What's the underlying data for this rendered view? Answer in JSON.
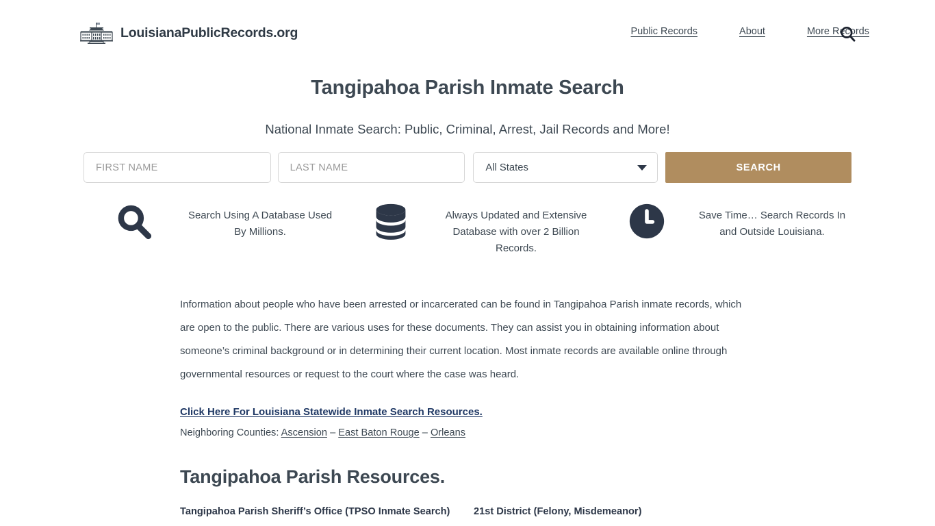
{
  "header": {
    "brand_name": "LouisianaPublicRecords.org",
    "brand_icon": "white-house-icon",
    "nav": [
      {
        "label": "Public Records"
      },
      {
        "label": "About"
      },
      {
        "label": "More Records"
      }
    ],
    "search_icon": "search-icon"
  },
  "hero": {
    "title": "Tangipahoa Parish Inmate Search",
    "subtitle": "National Inmate Search: Public, Criminal, Arrest, Jail Records and More!"
  },
  "search_form": {
    "first_name": {
      "value": "",
      "placeholder": "FIRST NAME"
    },
    "last_name": {
      "value": "",
      "placeholder": "LAST NAME"
    },
    "state_select": {
      "selected": "All States"
    },
    "submit_label": "SEARCH",
    "submit_color": "#b08d5f"
  },
  "features": [
    {
      "icon": "magnifier-icon",
      "text": "Search Using A Database Used By Millions."
    },
    {
      "icon": "database-icon",
      "text": "Always Updated and Extensive Database with over 2 Billion Records."
    },
    {
      "icon": "clock-icon",
      "text": "Save Time… Search Records In and Outside Louisiana."
    }
  ],
  "content": {
    "paragraph": "Information about people who have been arrested or incarcerated can be found in Tangipahoa Parish inmate records, which are open to the public. There are various uses for these documents. They can assist you in obtaining information about someone’s criminal background or in determining their current location. Most inmate records are available online through governmental resources or request to the court where the case was heard.",
    "statewide_link": "Click Here For Louisiana Statewide Inmate Search Resources.",
    "neighbors_label": "Neighboring Counties:",
    "neighbors": [
      {
        "label": "Ascension"
      },
      {
        "label": "East Baton Rouge"
      },
      {
        "label": "Orleans"
      }
    ],
    "neighbors_separator": "–",
    "resources_heading": "Tangipahoa Parish Resources.",
    "resources": [
      {
        "label": "Tangipahoa Parish Sheriff’s Office (TPSO Inmate Search)"
      },
      {
        "label": "21st District (Felony, Misdemeanor)"
      }
    ]
  }
}
